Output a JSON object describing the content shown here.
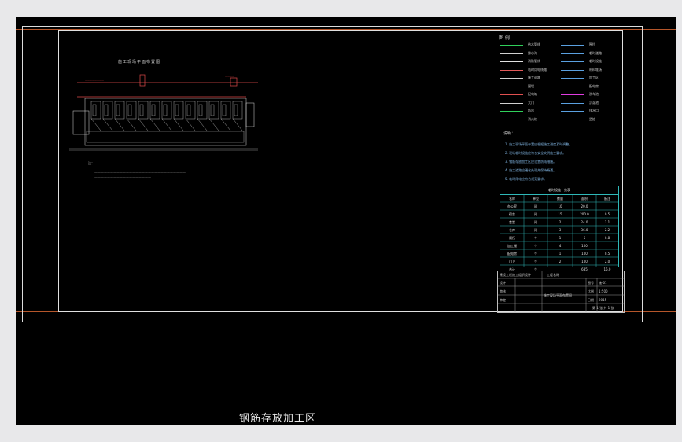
{
  "caption": "钢筋存放加工区",
  "legend": {
    "title": "图 例",
    "items": [
      {
        "label": "给水管线",
        "color": "#2fd05a"
      },
      {
        "label": "排水沟",
        "color": "#d0d0d0"
      },
      {
        "label": "消防管线",
        "color": "#e0e0e0"
      },
      {
        "label": "临时用电线路",
        "color": "#e35a5a"
      },
      {
        "label": "施工道路",
        "color": "#d0d0d0"
      },
      {
        "label": "围墙",
        "color": "#d0d0d0"
      },
      {
        "label": "配电箱",
        "color": "#e05050"
      },
      {
        "label": "大门",
        "color": "#d0d0d0"
      },
      {
        "label": "塔吊",
        "color": "#2fd05a"
      },
      {
        "label": "消火栓",
        "color": "#5aa0e0"
      }
    ],
    "items_right": [
      {
        "label": "围挡",
        "color": "#5aa0e0"
      },
      {
        "label": "临时道路",
        "color": "#5aa0e0"
      },
      {
        "label": "临时设施",
        "color": "#5aa0e0"
      },
      {
        "label": "材料堆场",
        "color": "#5aa0e0"
      },
      {
        "label": "加工区",
        "color": "#5aa0e0"
      },
      {
        "label": "配电房",
        "color": "#5aa0e0"
      },
      {
        "label": "洗车池",
        "color": "#e03ce0"
      },
      {
        "label": "沉淀池",
        "color": "#5aa0e0"
      },
      {
        "label": "排水口",
        "color": "#5aa0e0"
      },
      {
        "label": "监控",
        "color": "#5aa0e0"
      }
    ]
  },
  "notes": {
    "title": "说明：",
    "lines": [
      "1. 施工现场平面布置应根据施工进度及时调整。",
      "2. 现场临时设施应符合安全文明施工要求。",
      "3. 钢筋存放加工区应设置防雨措施。",
      "4. 施工道路应硬化处理并保持畅通。",
      "5. 临时用电应符合规范要求。"
    ]
  },
  "table": {
    "caption": "临时设施一览表",
    "headers": [
      "名称",
      "单位",
      "数量",
      "面积",
      "备注"
    ],
    "rows": [
      [
        "办公室",
        "间",
        "10",
        "20.0",
        ""
      ],
      [
        "宿舍",
        "间",
        "15",
        "200.0",
        "0.5"
      ],
      [
        "食堂",
        "间",
        "2",
        "24.0",
        "2.1"
      ],
      [
        "仓库",
        "间",
        "3",
        "36.0",
        "2.2"
      ],
      [
        "厕所",
        "个",
        "1",
        "5",
        "0.8"
      ],
      [
        "加工棚",
        "个",
        "4",
        "100",
        ""
      ],
      [
        "配电房",
        "个",
        "1",
        "100",
        "0.5"
      ],
      [
        "门卫",
        "个",
        "2",
        "100",
        "2.0"
      ],
      [
        "合计",
        "个",
        "",
        "685",
        "15.0"
      ]
    ]
  },
  "plan": {
    "title": "施工现场平面布置图"
  },
  "titleblock": {
    "company": "建设工程施工组织设计",
    "project": "工程名称",
    "drawing_name": "施工现场平面布置图",
    "rows": [
      [
        "设计",
        "",
        "图号",
        "施-01"
      ],
      [
        "审核",
        "",
        "比例",
        "1:500"
      ],
      [
        "审定",
        "",
        "日期",
        "2015"
      ]
    ],
    "sheet": "第 1 张 共 1 张"
  }
}
